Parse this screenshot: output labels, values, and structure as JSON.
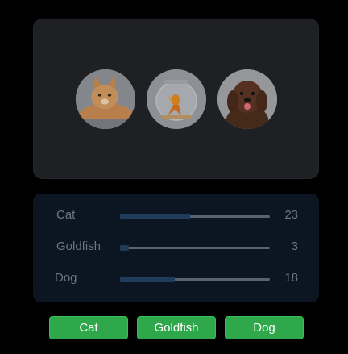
{
  "gallery": {
    "pets": [
      {
        "name": "Cat",
        "icon": "cat-photo"
      },
      {
        "name": "Goldfish",
        "icon": "goldfish-photo"
      },
      {
        "name": "Dog",
        "icon": "dog-photo"
      }
    ]
  },
  "votes": [
    {
      "label": "Cat",
      "count": "23",
      "value": 23
    },
    {
      "label": "Goldfish",
      "count": "3",
      "value": 3
    },
    {
      "label": "Dog",
      "count": "18",
      "value": 18
    }
  ],
  "vote_max": 49,
  "buttons": [
    {
      "label": "Cat"
    },
    {
      "label": "Goldfish"
    },
    {
      "label": "Dog"
    }
  ],
  "colors": {
    "button_green": "#2ea84a",
    "bar_fill": "#1f3c5c",
    "panel_bg": "#1e2024",
    "vote_panel_bg": "#0b1622"
  }
}
